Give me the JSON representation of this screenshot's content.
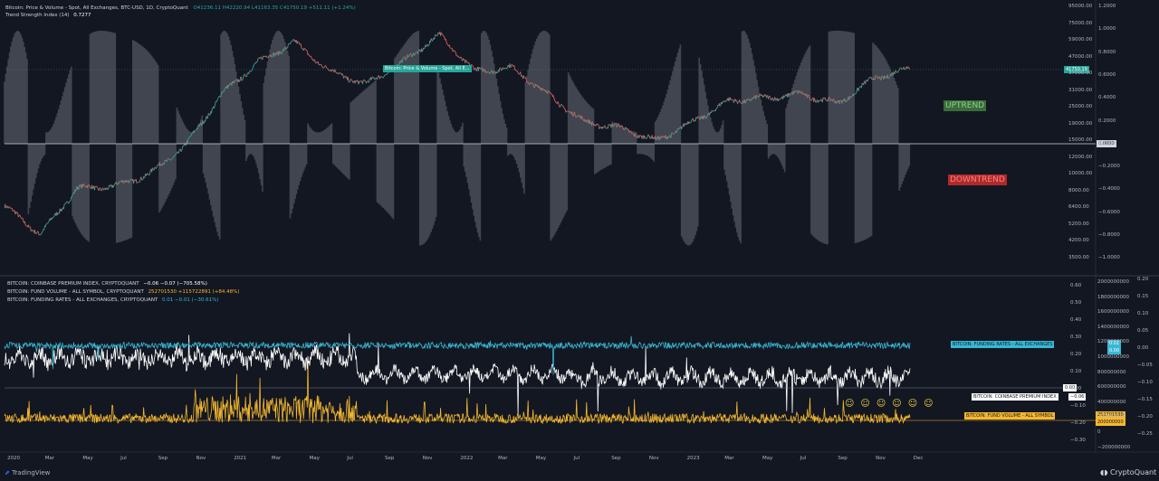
{
  "colors": {
    "background": "#131722",
    "price_up": "#26a69a",
    "price_down": "#ef5350",
    "tsi_band": "#4a4d57",
    "premium": "#ffffff",
    "fund_volume": "#f5b82e",
    "funding_rates": "#37b8d4",
    "uptrend_bg": "#3b6b3b",
    "uptrend_text": "#8fd18f",
    "downtrend_bg": "#b02a2a",
    "downtrend_text": "#ff8080"
  },
  "header": {
    "line1_title": "Bitcoin: Price & Volume - Spot, All Exchanges, BTC-USD, 1D, CryptoQuant",
    "line1_ohlc": "O41236.11  H42220.94  L41163.35  C41750.19  +511.11 (+1.24%)",
    "line2_name": "Trend Strength Index (14)",
    "line2_value": "0.7277"
  },
  "lower_legend": [
    {
      "name": "BITCOIN: COINBASE PREMIUM INDEX, CRYPTOQUANT",
      "values": "−0.06  −0.07 (−705.58%)"
    },
    {
      "name": "BITCOIN: FUND VOLUME - ALL SYMBOL, CRYPTOQUANT",
      "values": "252701530  +115722891 (+84.48%)"
    },
    {
      "name": "BITCOIN: FUNDING RATES - ALL EXCHANGES, CRYPTOQUANT",
      "values": "0.01  −0.01 (−30.61%)"
    }
  ],
  "annotations": {
    "uptrend": "UPTREND",
    "downtrend": "DOWNTREND",
    "price_series_label": "Bitcoin: Price & Volume - Spot, All E...",
    "smileys": "☺☺☺☺☺☺"
  },
  "tags": {
    "price": "41750.19",
    "tsi_zero": "0.0000",
    "funding_label": "BITCOIN: FUNDING RATES - ALL EXCHANGES",
    "funding_v1": "0.01",
    "funding_v2": "0.00",
    "premium_label": "BITCOIN: COINBASE PREMIUM INDEX",
    "premium_v": "−0.06",
    "premium_zero": "0.00",
    "fund_label": "BITCOIN: FUND VOLUME - ALL SYMBOL",
    "fund_v1": "252701530",
    "fund_v2": "200000000"
  },
  "axes": {
    "price_ticks": [
      "95000.00",
      "75000.00",
      "59000.00",
      "47000.00",
      "37000.00",
      "31000.00",
      "25000.00",
      "19000.00",
      "15000.00",
      "12000.00",
      "10000.00",
      "8000.00",
      "6400.00",
      "5200.00",
      "4200.00",
      "3500.00"
    ],
    "tsi_ticks": [
      "1.2000",
      "1.0000",
      "0.8000",
      "0.6000",
      "0.4000",
      "0.2000",
      "0.0000",
      "−0.2000",
      "−0.4000",
      "−0.6000",
      "−0.8000",
      "−1.0000"
    ],
    "premium_ticks": [
      "0.60",
      "0.50",
      "0.40",
      "0.30",
      "0.20",
      "0.10",
      "0.00",
      "−0.10",
      "−0.20",
      "−0.30"
    ],
    "volume_ticks": [
      "2000000000",
      "1800000000",
      "1600000000",
      "1400000000",
      "1200000000",
      "1000000000",
      "800000000",
      "600000000",
      "400000000",
      "200000000",
      "0",
      "−200000000"
    ],
    "funding_ticks": [
      "0.20",
      "0.15",
      "0.10",
      "0.05",
      "0.00",
      "−0.05",
      "−0.10",
      "−0.15",
      "−0.20",
      "−0.25"
    ],
    "x_ticks": [
      "2020",
      "Mar",
      "May",
      "Jul",
      "Sep",
      "Nov",
      "2021",
      "Mar",
      "May",
      "Jul",
      "Sep",
      "Nov",
      "2022",
      "Mar",
      "May",
      "Jul",
      "Sep",
      "Nov",
      "2023",
      "Mar",
      "May",
      "Jul",
      "Sep",
      "Nov",
      "Dec"
    ]
  },
  "footer": {
    "left": "TradingView",
    "right": "CryptoQuant"
  },
  "chart_data": {
    "type": "line",
    "panes": [
      {
        "name": "Bitcoin: Price & Volume - Spot, All Exchanges, BTC-USD, 1D",
        "scale": "log",
        "ylim": [
          3200,
          95000
        ],
        "series": [
          {
            "name": "Bitcoin price",
            "x": [
              "2020-01",
              "2020-03",
              "2020-05",
              "2020-07",
              "2020-09",
              "2020-11",
              "2021-01",
              "2021-02",
              "2021-04",
              "2021-05",
              "2021-07",
              "2021-09",
              "2021-11",
              "2022-01",
              "2022-03",
              "2022-05",
              "2022-07",
              "2022-09",
              "2022-11",
              "2023-01",
              "2023-03",
              "2023-05",
              "2023-07",
              "2023-09",
              "2023-11",
              "2023-12"
            ],
            "values": [
              7200,
              5000,
              9000,
              9200,
              10800,
              15500,
              30000,
              45000,
              58000,
              40000,
              34000,
              45000,
              64000,
              40000,
              42000,
              30000,
              21000,
              19500,
              16500,
              21000,
              27500,
              28500,
              30000,
              26500,
              36500,
              41750
            ]
          }
        ]
      },
      {
        "name": "Trend Strength Index (14)",
        "ylim": [
          -1.1,
          1.2
        ],
        "series": [
          {
            "name": "Trend Strength Index (14)",
            "last": 0.7277
          }
        ]
      },
      {
        "name": "Coinbase premium / Fund volume / Funding rates",
        "series": [
          {
            "name": "BITCOIN: COINBASE PREMIUM INDEX",
            "last": -0.06,
            "ylim": [
              -0.35,
              0.65
            ]
          },
          {
            "name": "BITCOIN: FUND VOLUME - ALL SYMBOL",
            "last": 252701530,
            "ylim": [
              -200000000,
              2000000000
            ]
          },
          {
            "name": "BITCOIN: FUNDING RATES - ALL EXCHANGES",
            "last": 0.01,
            "ylim": [
              -0.25,
              0.2
            ]
          }
        ]
      }
    ]
  }
}
